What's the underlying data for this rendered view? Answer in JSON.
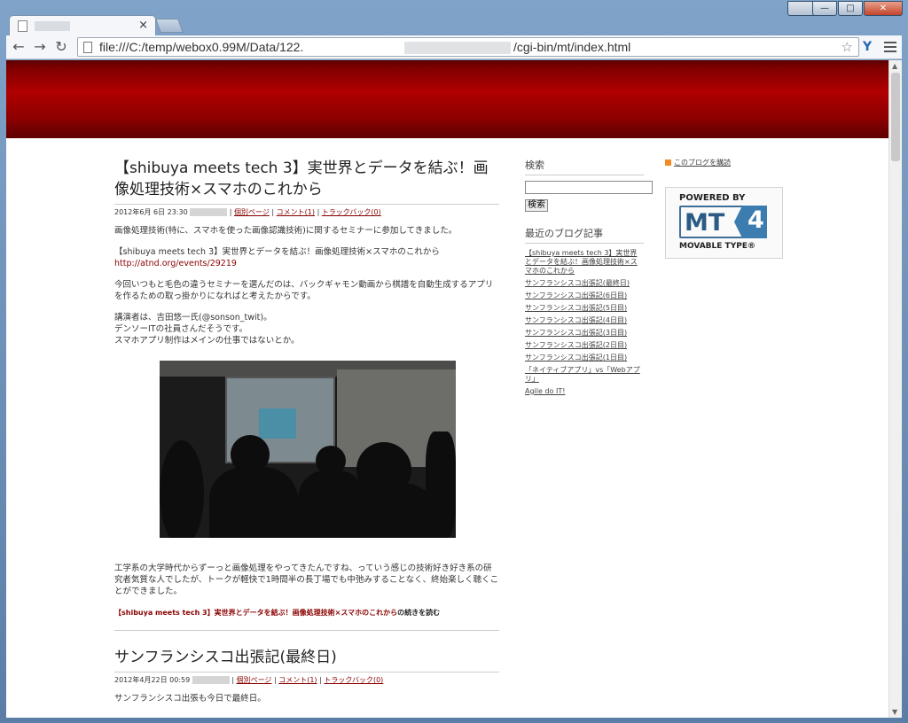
{
  "browser": {
    "url_prefix": "file:///C:/temp/webox0.99M/Data/122.",
    "url_suffix": "/cgi-bin/mt/index.html",
    "tab_close": "×",
    "nav": {
      "back": "←",
      "forward": "→",
      "reload": "↻"
    },
    "star": "☆",
    "ext": "Y",
    "window_buttons": {
      "minimize": "—",
      "maximize": "□",
      "close": "✕"
    }
  },
  "post1": {
    "title": "【shibuya meets tech 3】実世界とデータを結ぶ！画像処理技術×スマホのこれから",
    "date": "2012年6月 6日 23:30",
    "sep": "|",
    "permalink": "個別ページ",
    "comments": "コメント(1)",
    "trackback": "トラックバック(0)",
    "p1": "画像処理技術(特に、スマホを使った画像認識技術)に関するセミナーに参加してきました。",
    "p2_text": "【shibuya meets tech 3】実世界とデータを結ぶ！画像処理技術×スマホのこれから",
    "p2_link": "http://atnd.org/events/29219",
    "p3": "今回いつもと毛色の違うセミナーを選んだのは、バックギャモン動画から棋譜を自動生成するアプリを作るための取っ掛かりになればと考えたからです。",
    "p4_l1": "講演者は、吉田悠一氏(@sonson_twit)。",
    "p4_l2": "デンソーITの社員さんだそうです。",
    "p4_l3": "スマホアプリ制作はメインの仕事ではないとか。",
    "p5": "工学系の大学時代からずーっと画像処理をやってきたんですね、っていう感じの技術好き好き系の研究者気質な人でしたが、トークが軽快で1時間半の長丁場でも中弛みすることなく、終始楽しく聴くことができました。",
    "readmore_link": "【shibuya meets tech 3】実世界とデータを結ぶ！画像処理技術×スマホのこれから",
    "readmore_suffix": "の続きを読む"
  },
  "post2": {
    "title": "サンフランシスコ出張記(最終日)",
    "date": "2012年4月22日 00:59",
    "sep": "|",
    "permalink": "個別ページ",
    "comments": "コメント(1)",
    "trackback": "トラックバック(0)",
    "p1": "サンフランシスコ出張も今日で最終日。"
  },
  "sidebar": {
    "search_heading": "検索",
    "search_value": "",
    "search_button": "検索",
    "recent_heading": "最近のブログ記事",
    "recent": [
      "【shibuya meets tech 3】実世界とデータを結ぶ！画像処理技術×スマホのこれから",
      "サンフランシスコ出張記(最終日)",
      "サンフランシスコ出張記(6日目)",
      "サンフランシスコ出張記(5日目)",
      "サンフランシスコ出張記(4日目)",
      "サンフランシスコ出張記(3日目)",
      "サンフランシスコ出張記(2日目)",
      "サンフランシスコ出張記(1日目)",
      "「ネイティブアプリ」vs「Webアプリ」",
      "Agile do IT!"
    ],
    "feed_link": "このブログを購読",
    "mt_powered": "POWERED BY",
    "mt_logo": "MT",
    "mt_version": "4",
    "mt_name": "MOVABLE TYPE®"
  },
  "colors": {
    "banner": "#8c0000",
    "link": "#8a0000"
  }
}
